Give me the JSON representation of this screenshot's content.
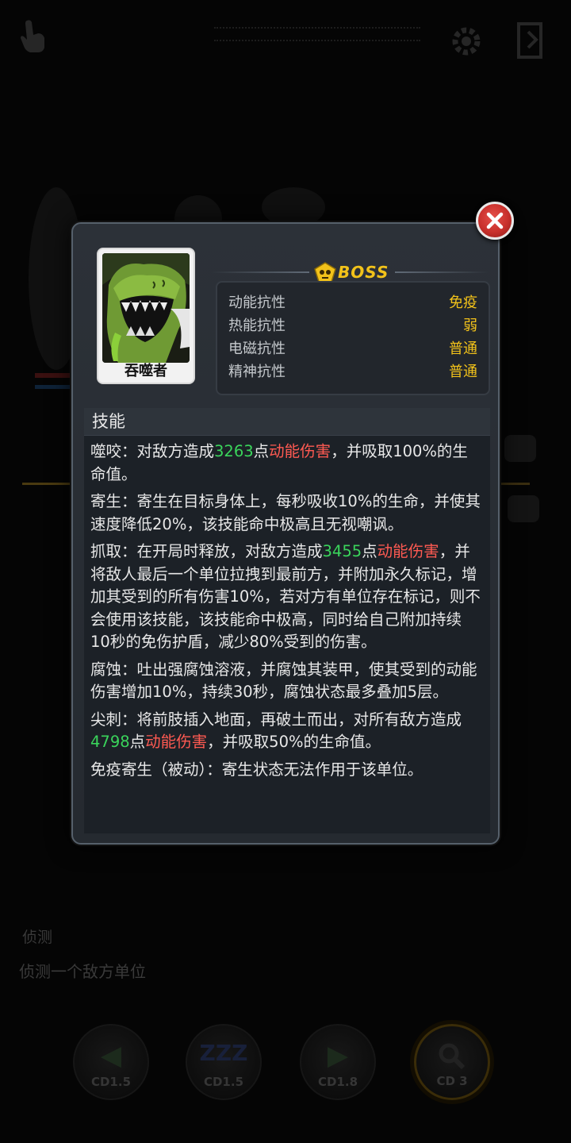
{
  "background": {
    "description_title": "侦测",
    "description_text": "侦测一个敌方单位",
    "skill_buttons": [
      {
        "cd": "CD1.5",
        "icon": "green-arrow-left-icon"
      },
      {
        "cd": "CD1.5",
        "icon": "sleep-zzz-icon"
      },
      {
        "cd": "CD1.8",
        "icon": "green-arrow-right-icon"
      },
      {
        "cd": "CD 3",
        "icon": "magnifier-icon",
        "selected": true
      }
    ]
  },
  "dialog": {
    "portrait_name": "吞噬者",
    "rank_label": "BOSS",
    "resistances": [
      {
        "name": "动能抗性",
        "value": "免疫"
      },
      {
        "name": "热能抗性",
        "value": "弱"
      },
      {
        "name": "电磁抗性",
        "value": "普通"
      },
      {
        "name": "精神抗性",
        "value": "普通"
      }
    ],
    "skills_heading": "技能",
    "skills": [
      {
        "segments": [
          {
            "text": "噬咬：对敌方造成",
            "style": "plain"
          },
          {
            "text": "3263",
            "style": "num"
          },
          {
            "text": "点",
            "style": "plain"
          },
          {
            "text": "动能伤害",
            "style": "dmg"
          },
          {
            "text": "，并吸取100%的生命值。",
            "style": "plain"
          }
        ]
      },
      {
        "segments": [
          {
            "text": "寄生：寄生在目标身体上，每秒吸收10%的生命，并使其速度降低20%，该技能命中极高且无视嘲讽。",
            "style": "plain"
          }
        ]
      },
      {
        "segments": [
          {
            "text": "抓取：在开局时释放，对敌方造成",
            "style": "plain"
          },
          {
            "text": "3455",
            "style": "num"
          },
          {
            "text": "点",
            "style": "plain"
          },
          {
            "text": "动能伤害",
            "style": "dmg"
          },
          {
            "text": "，并将敌人最后一个单位拉拽到最前方，并附加永久标记，增加其受到的所有伤害10%，若对方有单位存在标记，则不会使用该技能，该技能命中极高，同时给自己附加持续10秒的免伤护盾，减少80%受到的伤害。",
            "style": "plain"
          }
        ]
      },
      {
        "segments": [
          {
            "text": "腐蚀：吐出强腐蚀溶液，并腐蚀其装甲，使其受到的动能伤害增加10%，持续30秒，腐蚀状态最多叠加5层。",
            "style": "plain"
          }
        ]
      },
      {
        "segments": [
          {
            "text": "尖刺：将前肢插入地面，再破土而出，对所有敌方造成",
            "style": "plain"
          },
          {
            "text": "4798",
            "style": "num"
          },
          {
            "text": "点",
            "style": "plain"
          },
          {
            "text": "动能伤害",
            "style": "dmg"
          },
          {
            "text": "，并吸取50%的生命值。",
            "style": "plain"
          }
        ]
      },
      {
        "segments": [
          {
            "text": "免疫寄生（被动）：寄生状态无法作用于该单位。",
            "style": "plain"
          }
        ]
      }
    ]
  },
  "colors": {
    "accent_gold": "#f2c21a",
    "number_green": "#3ad45b",
    "damage_red": "#ff5a52",
    "close_red": "#c8302c"
  }
}
